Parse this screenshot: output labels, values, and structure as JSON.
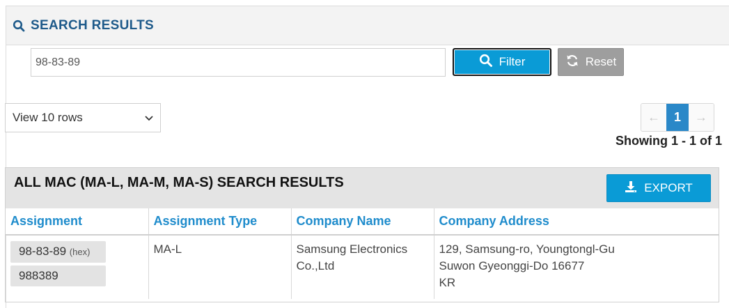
{
  "header": {
    "title": "SEARCH RESULTS",
    "icon": "search-icon"
  },
  "search": {
    "value": "98-83-89",
    "placeholder": ""
  },
  "buttons": {
    "filter": "Filter",
    "reset": "Reset",
    "export": "EXPORT"
  },
  "rows_select": {
    "value": "View 10 rows"
  },
  "pagination": {
    "prev": "←",
    "current": "1",
    "next": "→",
    "showing": "Showing 1 - 1 of 1"
  },
  "results": {
    "title": "ALL MAC (MA-L, MA-M, MA-S) SEARCH RESULTS",
    "columns": [
      "Assignment",
      "Assignment Type",
      "Company Name",
      "Company Address"
    ],
    "rows": [
      {
        "assignment_hex": "98-83-89",
        "hex_suffix": "(hex)",
        "assignment_base16": "988389",
        "type": "MA-L",
        "company_name_line1": "Samsung Electronics",
        "company_name_line2": "Co.,Ltd",
        "address_line1": "129, Samsung-ro, Youngtongl-Gu",
        "address_line2": "Suwon Gyeonggi-Do 16677",
        "address_line3": "KR"
      }
    ]
  },
  "colors": {
    "accent": "#0a9bd6",
    "header_text": "#1e5a8a",
    "column_header": "#1f8ccc",
    "reset": "#9e9e9e"
  }
}
